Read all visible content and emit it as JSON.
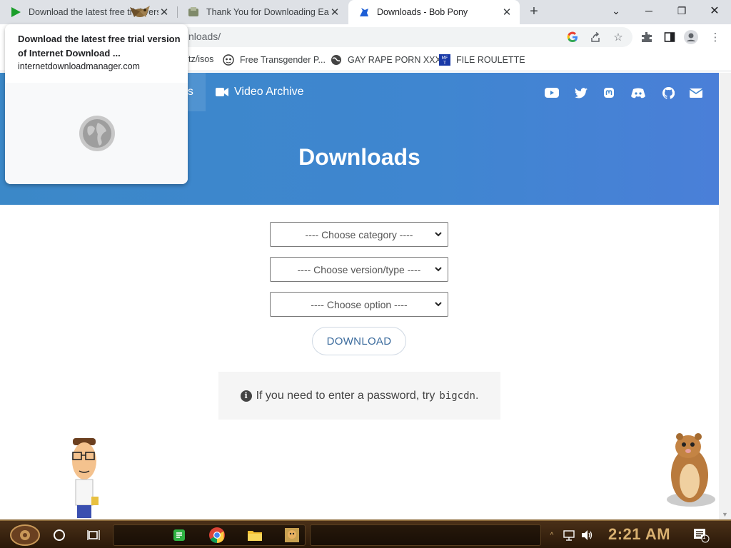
{
  "browser": {
    "tabs": [
      {
        "title": "Download the latest free trial version of Internet Download Manager",
        "active": false
      },
      {
        "title": "Thank You for Downloading Easy",
        "active": false
      },
      {
        "title": "Downloads - Bob Pony",
        "active": true
      }
    ],
    "url": "nloads/",
    "url_fragment": "tz/isos",
    "bookmarks": [
      {
        "label": "Free Transgender P...",
        "icon": "mask-icon"
      },
      {
        "label": "GAY RAPE PORN XXX",
        "icon": "globe-icon"
      },
      {
        "label": "FILE ROULETTE",
        "icon": "mft-icon"
      }
    ]
  },
  "tooltip": {
    "title": "Download the latest free trial version of Internet Download ...",
    "domain": "internetdownloadmanager.com"
  },
  "nav": {
    "active_fragment": "ds",
    "video_archive": "Video Archive",
    "social_icons": [
      "youtube-icon",
      "twitter-icon",
      "mastodon-icon",
      "discord-icon",
      "github-icon",
      "mail-icon"
    ]
  },
  "page": {
    "title": "Downloads",
    "category_select": "---- Choose category ----",
    "version_select": "---- Choose version/type ----",
    "option_select": "---- Choose option ----",
    "download_button": "DOWNLOAD",
    "notice_text": "If you need to enter a password, try",
    "notice_password": "bigcdn",
    "notice_end": "."
  },
  "taskbar": {
    "clock": "2:21 AM",
    "notification_count": "1"
  },
  "colors": {
    "hero_blue": "#3f86d0",
    "button_text": "#3b6b9d",
    "clock_gold": "#d8b070"
  }
}
